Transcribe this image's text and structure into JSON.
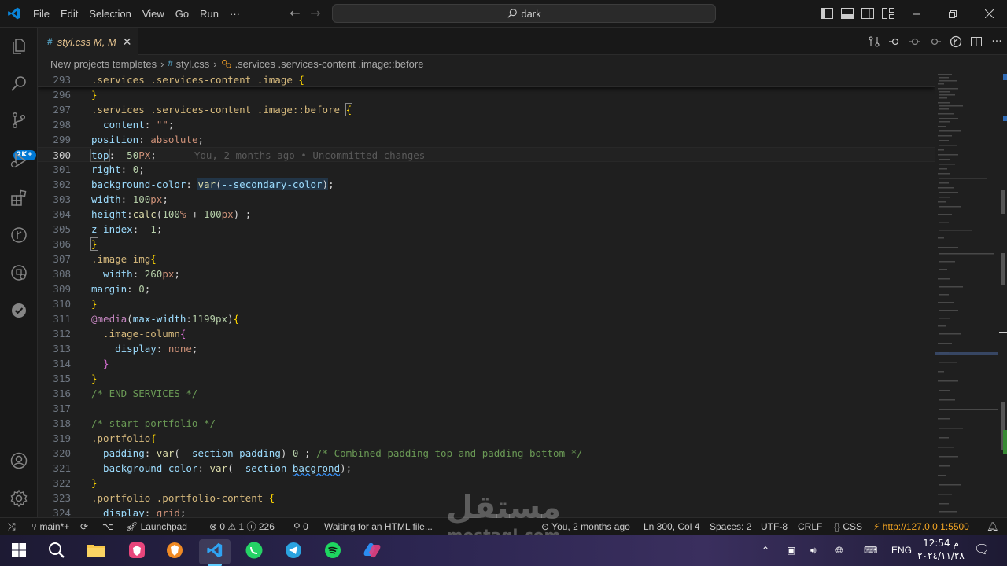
{
  "menu": [
    "File",
    "Edit",
    "Selection",
    "View",
    "Go",
    "Run",
    "···"
  ],
  "search": {
    "value": "dark"
  },
  "tab": {
    "label": "styl.css M, M",
    "icon": "css-file-icon"
  },
  "breadcrumb": {
    "folder": "New projects templetes",
    "file": "styl.css",
    "symbol": ".services .services-content .image::before"
  },
  "activity": {
    "badge": "2K+"
  },
  "blame": "You, 2 months ago • Uncommitted changes",
  "lines": [
    {
      "n": "293",
      "text": ".services .services-content .image {"
    },
    {
      "n": "296",
      "text": "}"
    },
    {
      "n": "297",
      "text": ".services .services-content .image::before {"
    },
    {
      "n": "298",
      "text": "  content: \"\";"
    },
    {
      "n": "299",
      "text": "position: absolute;"
    },
    {
      "n": "300",
      "text": "top: -50PX;"
    },
    {
      "n": "301",
      "text": "right: 0;"
    },
    {
      "n": "302",
      "text": "background-color: var(--secondary-color);"
    },
    {
      "n": "303",
      "text": "width: 100px;"
    },
    {
      "n": "304",
      "text": "height:calc(100% + 100px) ;"
    },
    {
      "n": "305",
      "text": "z-index: -1;"
    },
    {
      "n": "306",
      "text": "}"
    },
    {
      "n": "307",
      "text": ".image img{"
    },
    {
      "n": "308",
      "text": "  width: 260px;"
    },
    {
      "n": "309",
      "text": "margin: 0;"
    },
    {
      "n": "310",
      "text": "}"
    },
    {
      "n": "311",
      "text": "@media(max-width:1199px){"
    },
    {
      "n": "312",
      "text": "  .image-column{"
    },
    {
      "n": "313",
      "text": "    display: none;"
    },
    {
      "n": "314",
      "text": "  }"
    },
    {
      "n": "315",
      "text": "}"
    },
    {
      "n": "316",
      "text": "/* END SERVICES */"
    },
    {
      "n": "317",
      "text": ""
    },
    {
      "n": "318",
      "text": "/* start portfolio */"
    },
    {
      "n": "319",
      "text": ".portfolio{"
    },
    {
      "n": "320",
      "text": "  padding: var(--section-padding) 0 ; /* Combined padding-top and padding-bottom */"
    },
    {
      "n": "321",
      "text": "  background-color: var(--section-bacgrond);"
    },
    {
      "n": "322",
      "text": "}"
    },
    {
      "n": "323",
      "text": ".portfolio .portfolio-content {"
    },
    {
      "n": "324",
      "text": "  display: grid;"
    }
  ],
  "status": {
    "branch": "main*+",
    "launchpad": "Launchpad",
    "errors": "0",
    "warnings": "1",
    "info": "226",
    "ports": "0",
    "waiting": "Waiting for an HTML file...",
    "blame": "You, 2 months ago",
    "position": "Ln 300, Col 4",
    "spaces": "Spaces: 2",
    "encoding": "UTF-8",
    "eol": "CRLF",
    "language": "CSS",
    "server": "http://127.0.0.1:5500"
  },
  "taskbar": {
    "lang": "ENG",
    "time": "12:54 م",
    "date": "٢٠٢٤/١١/٢٨",
    "apps": [
      "windows-start-icon",
      "search-icon",
      "file-explorer-icon",
      "brave-icon",
      "browser-icon",
      "vscode-icon",
      "whatsapp-icon",
      "telegram-icon",
      "spotify-icon",
      "copilot-icon"
    ]
  },
  "watermark": {
    "ar": "مستقل",
    "en": "mostaql.com"
  },
  "colors": {
    "accent": "#0078d4",
    "bg": "#1f1f1f",
    "selector": "#d7ba7d",
    "property": "#9cdcfe",
    "number": "#b5cea8",
    "comment": "#6a9955"
  }
}
